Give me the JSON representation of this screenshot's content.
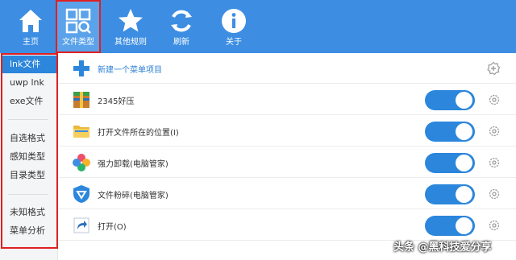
{
  "toolbar": {
    "items": [
      {
        "label": "主页",
        "icon": "home-icon"
      },
      {
        "label": "文件类型",
        "icon": "file-type-icon",
        "active": true
      },
      {
        "label": "其他规则",
        "icon": "star-icon"
      },
      {
        "label": "刷新",
        "icon": "refresh-icon"
      },
      {
        "label": "关于",
        "icon": "info-icon"
      }
    ]
  },
  "sidebar": {
    "items": [
      {
        "label": "lnk文件",
        "active": true
      },
      {
        "label": "uwp lnk"
      },
      {
        "label": "exe文件"
      },
      {
        "label": "自选格式"
      },
      {
        "label": "感知类型"
      },
      {
        "label": "目录类型"
      },
      {
        "label": "未知格式"
      },
      {
        "label": "菜单分析"
      }
    ]
  },
  "main": {
    "new_item_label": "新建一个菜单项目",
    "rows": [
      {
        "label": "2345好压",
        "icon": "archive-icon",
        "enabled": true
      },
      {
        "label": "打开文件所在的位置(I)",
        "icon": "folder-icon",
        "enabled": true
      },
      {
        "label": "强力卸载(电脑管家)",
        "icon": "uninstall-icon",
        "enabled": true
      },
      {
        "label": "文件粉碎(电脑管家)",
        "icon": "shield-icon",
        "enabled": true
      },
      {
        "label": "打开(O)",
        "icon": "shortcut-arrow-icon",
        "enabled": true
      }
    ]
  },
  "watermark": "头条 @黑科技爱分享",
  "colors": {
    "toolbar": "#3d8ee2",
    "accent": "#2b86dc",
    "highlight": "#e02020"
  }
}
